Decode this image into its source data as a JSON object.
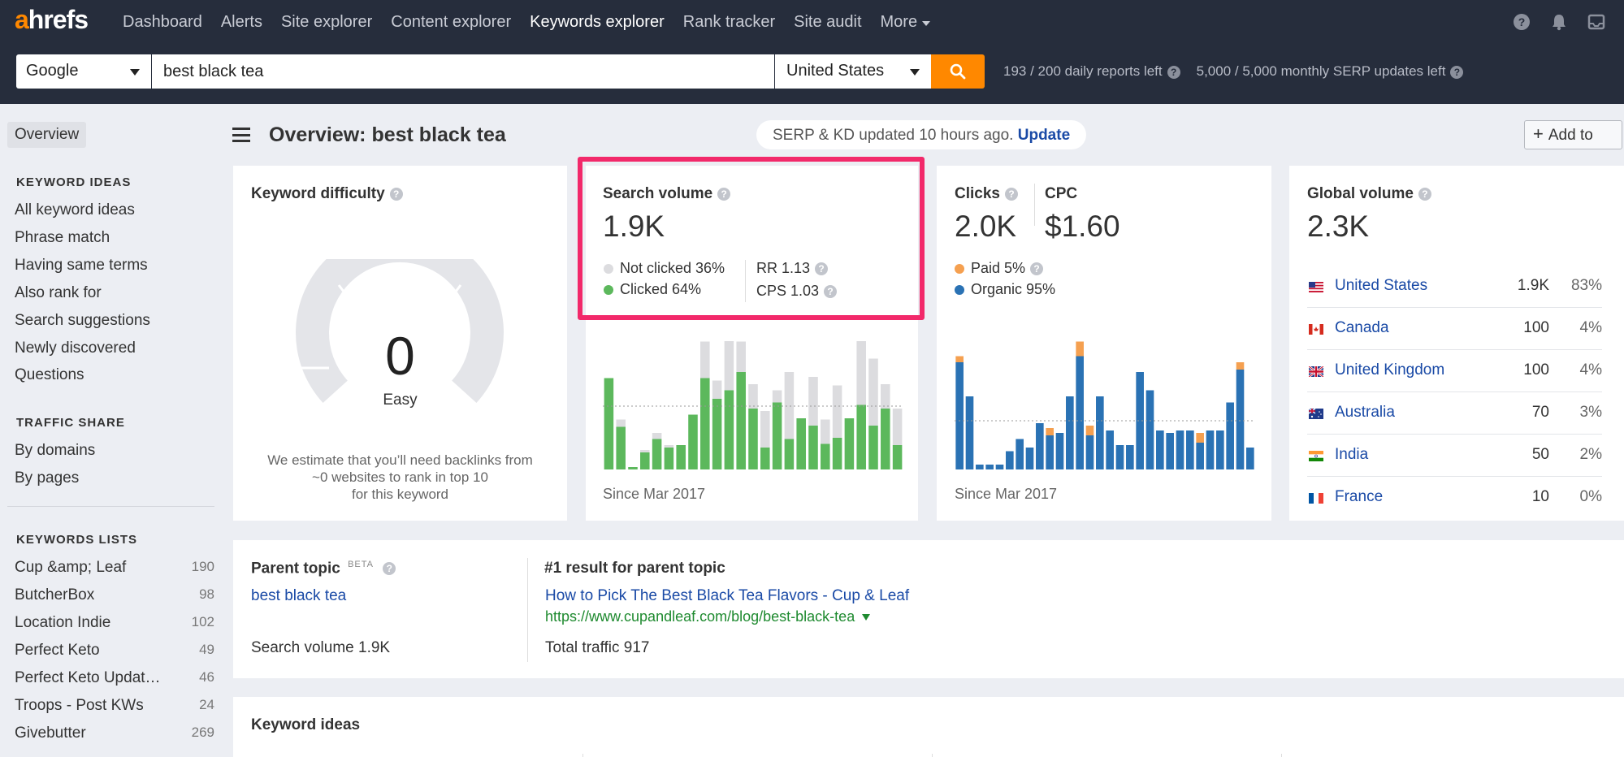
{
  "nav": {
    "logo": "ahrefs",
    "items": [
      "Dashboard",
      "Alerts",
      "Site explorer",
      "Content explorer",
      "Keywords explorer",
      "Rank tracker",
      "Site audit",
      "More"
    ],
    "active_index": 4
  },
  "search": {
    "engine": "Google",
    "keyword": "best black tea",
    "country": "United States",
    "daily_reports": "193 / 200 daily reports left",
    "serp_updates": "5,000 / 5,000 monthly SERP updates left"
  },
  "sidebar": {
    "overview": "Overview",
    "keyword_ideas_head": "KEYWORD IDEAS",
    "keyword_ideas": [
      "All keyword ideas",
      "Phrase match",
      "Having same terms",
      "Also rank for",
      "Search suggestions",
      "Newly discovered",
      "Questions"
    ],
    "traffic_share_head": "TRAFFIC SHARE",
    "traffic_share": [
      "By domains",
      "By pages"
    ],
    "lists_head": "KEYWORDS LISTS",
    "lists": [
      {
        "name": "Cup &amp; Leaf",
        "count": "190"
      },
      {
        "name": "ButcherBox",
        "count": "98"
      },
      {
        "name": "Location Indie",
        "count": "102"
      },
      {
        "name": "Perfect Keto",
        "count": "49"
      },
      {
        "name": "Perfect Keto Updat…",
        "count": "46"
      },
      {
        "name": "Troops - Post KWs",
        "count": "24"
      },
      {
        "name": "Givebutter",
        "count": "269"
      }
    ]
  },
  "header": {
    "title": "Overview: best black tea",
    "serp_status": "SERP & KD updated 10 hours ago.",
    "update_link": "Update",
    "add_to": "Add to"
  },
  "kd": {
    "title": "Keyword difficulty",
    "value": "0",
    "label": "Easy",
    "note_line1": "We estimate that you’ll need backlinks from",
    "note_line2": "~0 websites to rank in top 10",
    "note_line3": "for this keyword"
  },
  "sv": {
    "title": "Search volume",
    "value": "1.9K",
    "not_clicked": "Not clicked 36%",
    "clicked": "Clicked 64%",
    "rr": "RR 1.13",
    "cps": "CPS 1.03",
    "since": "Since Mar 2017"
  },
  "clicks": {
    "title": "Clicks",
    "value": "2.0K",
    "cpc_title": "CPC",
    "cpc_value": "$1.60",
    "paid": "Paid 5%",
    "organic": "Organic 95%",
    "since": "Since Mar 2017"
  },
  "gv": {
    "title": "Global volume",
    "value": "2.3K",
    "rows": [
      {
        "country": "United States",
        "volume": "1.9K",
        "pct": "83%"
      },
      {
        "country": "Canada",
        "volume": "100",
        "pct": "4%"
      },
      {
        "country": "United Kingdom",
        "volume": "100",
        "pct": "4%"
      },
      {
        "country": "Australia",
        "volume": "70",
        "pct": "3%"
      },
      {
        "country": "India",
        "volume": "50",
        "pct": "2%"
      },
      {
        "country": "France",
        "volume": "10",
        "pct": "0%"
      }
    ]
  },
  "parent": {
    "title": "Parent topic",
    "beta": "BETA",
    "topic": "best black tea",
    "volume": "Search volume 1.9K",
    "result_title": "#1 result for parent topic",
    "result_link": "How to Pick The Best Black Tea Flavors - Cup & Leaf",
    "result_url": "https://www.cupandleaf.com/blog/best-black-tea",
    "traffic": "Total traffic 917"
  },
  "ideas": {
    "title": "Keyword ideas"
  },
  "colors": {
    "accent": "#ff8800",
    "highlight": "#f2296a",
    "clicked": "#5cb85c",
    "not_clicked": "#dcdcdf",
    "organic": "#2a72b4",
    "paid": "#f5a050",
    "link": "#1a4aa6"
  },
  "chart_data": [
    {
      "type": "bar",
      "series": [
        {
          "name": "Clicked",
          "values": [
            0.75,
            0.35,
            0.02,
            0.14,
            0.25,
            0.18,
            0.2,
            0.45,
            0.75,
            0.58,
            0.65,
            0.8,
            0.5,
            0.18,
            0.55,
            0.25,
            0.42,
            0.36,
            0.21,
            0.26,
            0.42,
            0.53,
            0.36,
            0.5,
            0.2
          ]
        },
        {
          "name": "Not clicked",
          "values": [
            0.0,
            0.06,
            0.0,
            0.02,
            0.05,
            0.02,
            0.0,
            0.0,
            0.3,
            0.15,
            0.45,
            0.25,
            0.2,
            0.3,
            0.1,
            0.55,
            0.0,
            0.4,
            0.2,
            0.43,
            0.0,
            0.58,
            0.55,
            0.2,
            0.3
          ]
        }
      ],
      "since": "Since Mar 2017"
    },
    {
      "type": "bar",
      "series": [
        {
          "name": "Organic",
          "values": [
            0.88,
            0.6,
            0.04,
            0.04,
            0.04,
            0.15,
            0.25,
            0.18,
            0.38,
            0.28,
            0.3,
            0.6,
            0.93,
            0.28,
            0.6,
            0.32,
            0.2,
            0.2,
            0.8,
            0.65,
            0.32,
            0.3,
            0.32,
            0.32,
            0.22,
            0.32,
            0.32,
            0.55,
            0.82,
            0.18
          ]
        },
        {
          "name": "Paid",
          "values": [
            0.05,
            0.0,
            0.0,
            0.0,
            0.0,
            0.0,
            0.0,
            0.0,
            0.0,
            0.06,
            0.0,
            0.0,
            0.12,
            0.08,
            0.0,
            0.0,
            0.0,
            0.0,
            0.0,
            0.0,
            0.0,
            0.0,
            0.0,
            0.0,
            0.08,
            0.0,
            0.0,
            0.0,
            0.06,
            0.0
          ]
        }
      ],
      "since": "Since Mar 2017"
    }
  ]
}
